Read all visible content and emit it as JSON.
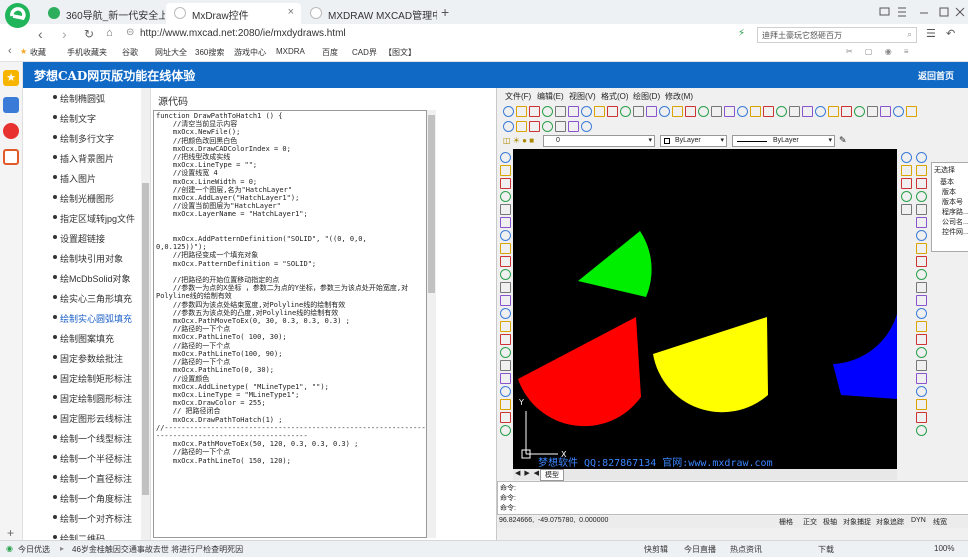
{
  "browser": {
    "tabs": [
      {
        "label": "360导航_新一代安全上网导航",
        "icon_color": "#2cae5c"
      },
      {
        "label": "MxDraw控件",
        "icon_color": "#d23c3c"
      },
      {
        "label": "MXDRAW MXCAD管理中心",
        "icon_color": "#6c6c6c"
      }
    ],
    "address": "http://www.mxcad.net:2080/ie/mxdydraws.html",
    "search_text": "迪拜土豪玩它怒砸百万",
    "favorites": [
      "收藏",
      "手机收藏夹",
      "谷歌",
      "网址大全",
      "360搜索",
      "游戏中心",
      "MXDRA",
      "百度",
      "CAD界",
      "【图文】"
    ]
  },
  "site": {
    "title": "梦想CAD网页版功能在线体验",
    "home_link": "返回首页",
    "code_label": "源代码",
    "menu_items": [
      "绘制椭圆弧",
      "绘制文字",
      "绘制多行文字",
      "插入背景图片",
      "插入图片",
      "绘制光栅图形",
      "指定区域转jpg文件",
      "设置超链接",
      "绘制块引用对象",
      "绘McDbSolid对象",
      "绘实心三角形填充",
      "绘制实心圆弧填充",
      "绘制图案填充",
      "固定参数绘批注",
      "固定绘制矩形标注",
      "固定绘制圆形标注",
      "固定图形云线标注",
      "绘制一个线型标注",
      "绘制一个半径标注",
      "绘制一个直径标注",
      "绘制一个角度标注",
      "绘制一个对齐标注",
      "绘制二维码"
    ],
    "active_index": 11,
    "code": "function DrawPathToHatch1 () {\n    //清空当前显示内容\n    mxOcx.NewFile();\n    //把颜色改回黑白色\n    mxOcx.DrawCADColorIndex = 0;\n    //把线型改成实线\n    mxOcx.LineType = \"\";\n    //设置线宽 4\n    mxOcx.LineWidth = 0;\n    //创建一个图层,名为\"HatchLayer\"\n    mxOcx.AddLayer(\"HatchLayer1\");\n    //设置当前图层为\"HatchLayer\"\n    mxOcx.LayerName = \"HatchLayer1\";\n\n\n    mxOcx.AddPatternDefinition(\"SOLID\", \"((0, 0,0,\n0,0.125))\");\n    //把路径变成一个填充对象\n    mxOcx.PatternDefinition = \"SOLID\";\n\n    //把路径的开始位置移动指定的点\n    //参数一为点的X坐标 ，参数二为点的Y坐标，参数三为该点处开始宽度,对\nPolyline线的绘制有效\n    //参数四为该点处结束宽度,对Polyline线的绘制有效\n    //参数五为该点处的凸度,对Polyline线的绘制有效\n    mxOcx.PathMoveToEx(0, 30, 0.3, 0.3, 0.3) ;\n    //路径的一下个点\n    mxOcx.PathLineTo( 100, 30);\n    //路径的一下个点\n    mxOcx.PathLineTo(100, 90);\n    //路径的一下个点\n    mxOcx.PathLineTo(0, 30);\n    //设置颜色\n    mxOcx.AddLinetype( \"MLineType1\", \"\");\n    mxOcx.LineType = \"MLineType1\";\n    mxOcx.DrawColor = 255;\n    // 把路径闭合\n    mxOcx.DrawPathToHatch(1) ;\n//-------------------------------------------------------------------\n------------------------------------\n    mxOcx.PathMoveToEx(50, 120, 0.3, 0.3, 0.3) ;\n    //路径的一下个点\n    mxOcx.PathLineTo( 150, 120);"
  },
  "cad": {
    "menus": [
      "文件(F)",
      "编辑(E)",
      "视图(V)",
      "格式(O)",
      "绘图(D)",
      "修改(M)"
    ],
    "layer_value": "0",
    "color_value": "ByLayer",
    "linetype_value": "ByLayer",
    "watermark": "梦想软件 QQ:827867134 官网:www.mxdraw.com",
    "model_tab": "模型",
    "command_lines": [
      "命令:",
      "命令:",
      "命令:"
    ],
    "coords": "96.824666,  -49.075780,  0.000000",
    "status_buttons": [
      "栅格",
      "正交",
      "极轴",
      "对象捕捉",
      "对象追踪",
      "DYN",
      "线宽"
    ],
    "props": {
      "header": "无选择",
      "section": "基本",
      "rows": [
        "版本",
        "版本号",
        "程序路...",
        "公司名...",
        "控件网..."
      ]
    },
    "fans": [
      {
        "name": "green",
        "color": "#00ee00"
      },
      {
        "name": "red",
        "color": "#ff0000"
      },
      {
        "name": "yellow",
        "color": "#ffff00"
      },
      {
        "name": "blue",
        "color": "#0000ff"
      }
    ]
  },
  "statusbar": {
    "left": "今日优选",
    "news": "46岁金桂触因交通事故去世 将进行尸检查明死因",
    "items": [
      "快剪辑",
      "今日直播",
      "热点资讯",
      "下载",
      "100%"
    ]
  }
}
